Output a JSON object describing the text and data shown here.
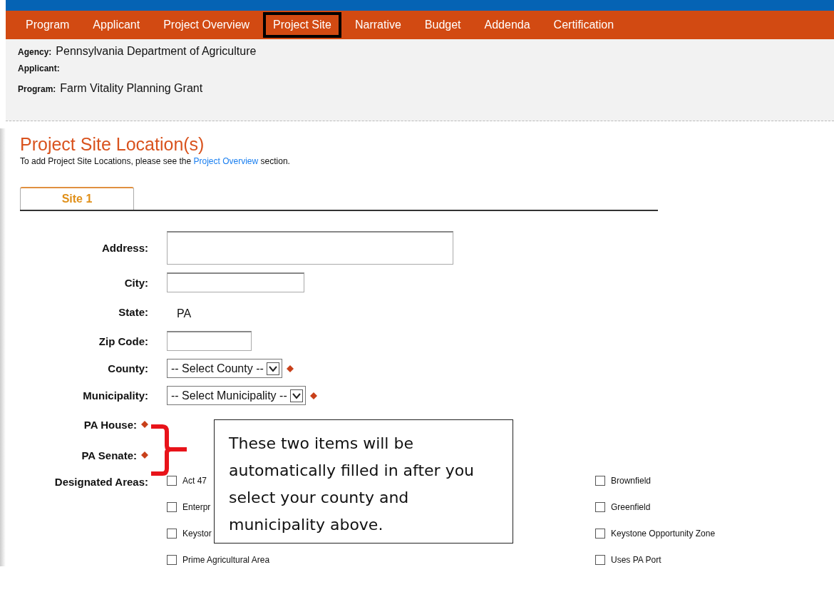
{
  "nav": [
    {
      "label": "Program",
      "selected": false
    },
    {
      "label": "Applicant",
      "selected": false
    },
    {
      "label": "Project Overview",
      "selected": false
    },
    {
      "label": "Project Site",
      "selected": true
    },
    {
      "label": "Narrative",
      "selected": false
    },
    {
      "label": "Budget",
      "selected": false
    },
    {
      "label": "Addenda",
      "selected": false
    },
    {
      "label": "Certification",
      "selected": false
    }
  ],
  "info": [
    {
      "label": "Agency:",
      "value": "Pennsylvania Department of Agriculture"
    },
    {
      "label": "Applicant:"
    },
    {
      "label": "Program:",
      "value": "Farm Vitality Planning Grant"
    }
  ],
  "heading": "Project Site Location(s)",
  "intro": {
    "before": "To add Project Site Locations, please see the",
    "link": "Project Overview",
    "after": "section."
  },
  "site_tabs": [
    {
      "label": "Site 1",
      "selected": true
    }
  ],
  "fields": [
    {
      "label": "Address:",
      "kind": "textarea",
      "required": false
    },
    {
      "label": "City:",
      "kind": "input",
      "required": false
    },
    {
      "label": "State:",
      "kind": "static",
      "value": "PA",
      "required": false
    },
    {
      "label": "Zip Code:",
      "kind": "zip",
      "required": false
    },
    {
      "label": "County:",
      "kind": "select",
      "value": "-- Select County --",
      "required": true
    },
    {
      "label": "Municipality:",
      "kind": "select",
      "value": "-- Select Municipality --",
      "required": true
    },
    {
      "label": "PA House:",
      "kind": "none",
      "required": true
    },
    {
      "label": "PA Senate:",
      "kind": "none",
      "required": true
    }
  ],
  "designated_areas": {
    "label": "Designated Areas:",
    "options": [
      {
        "label": "Act 47",
        "checked": false
      },
      {
        "label": "Brownfield",
        "checked": false
      },
      {
        "label": "Enterpr",
        "checked": false
      },
      {
        "label": "Greenfield",
        "checked": false
      },
      {
        "label": "Keystor",
        "checked": false
      },
      {
        "label": "Keystone Opportunity Zone",
        "checked": false
      },
      {
        "label": "Prime Agricultural Area",
        "checked": false
      },
      {
        "label": "Uses PA Port",
        "checked": false
      }
    ]
  },
  "callout": "These two items will be automatically filled in after you select your county and municipality above."
}
